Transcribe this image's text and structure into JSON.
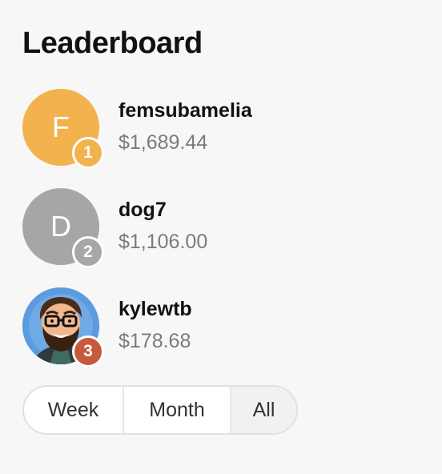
{
  "title": "Leaderboard",
  "colors": {
    "gold": "#f2b24d",
    "silver": "#a6a6a6",
    "bronze": "#c85a3c"
  },
  "entries": [
    {
      "rank": "1",
      "initial": "F",
      "name": "femsubamelia",
      "amount": "$1,689.44",
      "avatar_icon": "letter-avatar"
    },
    {
      "rank": "2",
      "initial": "D",
      "name": "dog7",
      "amount": "$1,106.00",
      "avatar_icon": "letter-avatar"
    },
    {
      "rank": "3",
      "initial": "",
      "name": "kylewtb",
      "amount": "$178.68",
      "avatar_icon": "cartoon-portrait-avatar"
    }
  ],
  "filters": {
    "options": [
      "Week",
      "Month",
      "All"
    ],
    "selected": "All"
  }
}
